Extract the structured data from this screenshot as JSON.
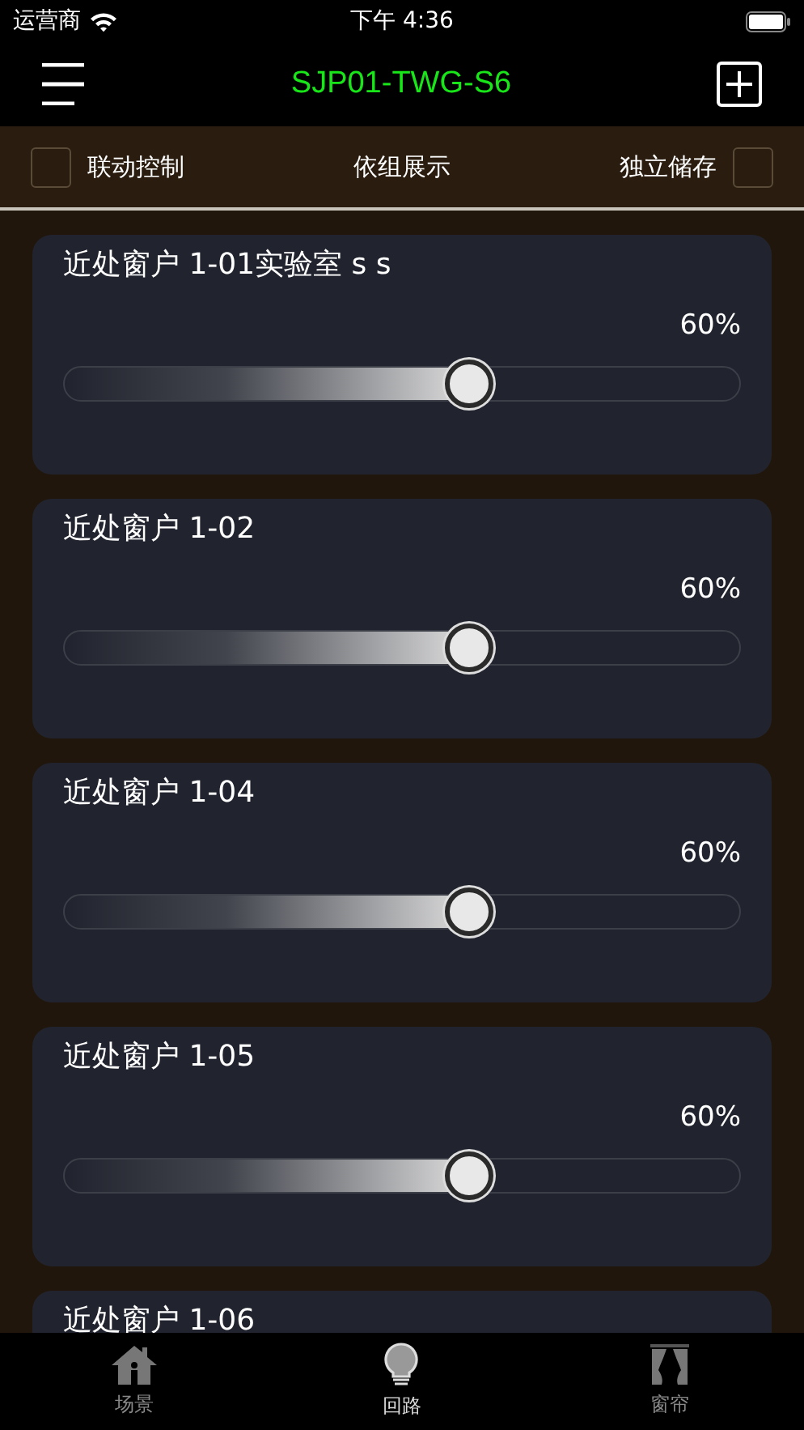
{
  "status_bar": {
    "carrier": "运营商",
    "time": "下午 4:36"
  },
  "nav": {
    "title": "SJP01-TWG-S6"
  },
  "toolbar": {
    "link_control": {
      "label": "联动控制",
      "checked": false
    },
    "group_view": "依组展示",
    "independent_store": {
      "label": "独立储存",
      "checked": false
    }
  },
  "channels": [
    {
      "name": "近处窗户 1-01实验室 s s",
      "reading": "60%",
      "level": 0.6
    },
    {
      "name": "近处窗户 1-02",
      "reading": "60%",
      "level": 0.6
    },
    {
      "name": "近处窗户 1-04",
      "reading": "60%",
      "level": 0.6
    },
    {
      "name": "近处窗户 1-05",
      "reading": "60%",
      "level": 0.6
    },
    {
      "name": "近处窗户 1-06"
    }
  ],
  "tabs": [
    {
      "kind": "house",
      "label": "场景",
      "selected": false
    },
    {
      "kind": "bulb",
      "label": "回路",
      "selected": true
    },
    {
      "kind": "curtain",
      "label": "窗帘",
      "selected": false
    }
  ]
}
